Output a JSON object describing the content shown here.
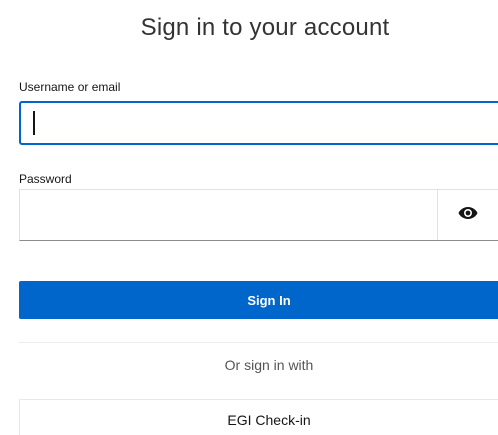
{
  "title": "Sign in to your account",
  "form": {
    "username_label": "Username or email",
    "username_value": "",
    "password_label": "Password",
    "password_value": "",
    "show_password_icon": "eye-icon",
    "submit_label": "Sign In"
  },
  "social": {
    "heading": "Or sign in with",
    "providers": [
      {
        "label": "EGI Check-in"
      }
    ]
  },
  "colors": {
    "primary": "#0066cc",
    "border": "#e2e2e2"
  }
}
